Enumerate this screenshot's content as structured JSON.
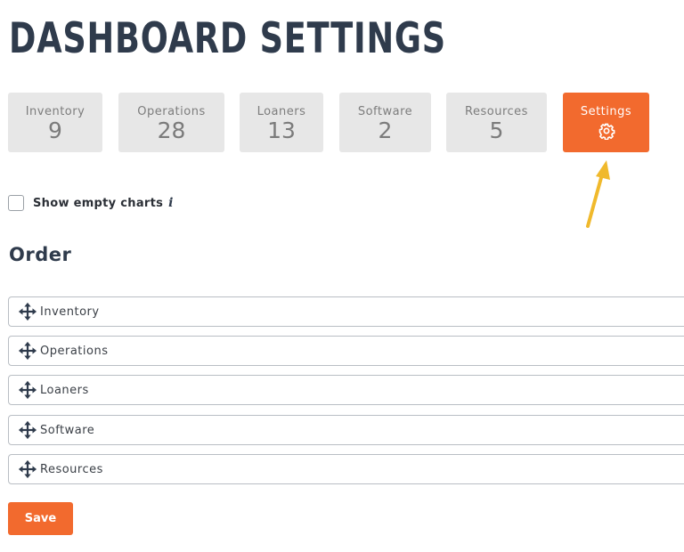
{
  "header": {
    "title": "DASHBOARD SETTINGS"
  },
  "tiles": [
    {
      "label": "Inventory",
      "count": "9"
    },
    {
      "label": "Operations",
      "count": "28"
    },
    {
      "label": "Loaners",
      "count": "13"
    },
    {
      "label": "Software",
      "count": "2"
    },
    {
      "label": "Resources",
      "count": "5"
    },
    {
      "label": "Settings",
      "icon": "gear-icon",
      "active": true
    }
  ],
  "options": {
    "show_empty_label": "Show empty charts",
    "show_empty_checked": false,
    "info_icon": "info-icon"
  },
  "order": {
    "heading": "Order",
    "items": [
      {
        "label": "Inventory",
        "icon": "move-icon"
      },
      {
        "label": "Operations",
        "icon": "move-icon"
      },
      {
        "label": "Loaners",
        "icon": "move-icon"
      },
      {
        "label": "Software",
        "icon": "move-icon"
      },
      {
        "label": "Resources",
        "icon": "move-icon"
      }
    ]
  },
  "actions": {
    "save_label": "Save"
  },
  "colors": {
    "accent": "#f26a2e",
    "tile_bg": "#e7e7e7",
    "title": "#2f3b4c",
    "annotation_arrow": "#f0b92c"
  }
}
